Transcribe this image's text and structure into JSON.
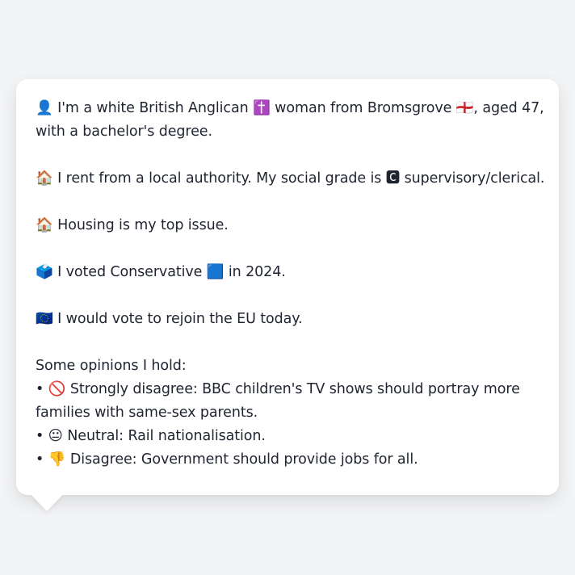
{
  "profile": {
    "identity_line1": "👤 I'm a white British Anglican ✝️ woman from Bromsgrove 🏴󠁧󠁢󠁥󠁮󠁧󠁿, aged 47,",
    "identity_line2": "with a bachelor's degree.",
    "housing_tenure": "🏠 I rent from a local authority. My social grade is 🅲 supervisory/clerical.",
    "top_issue": "🏠 Housing is my top issue.",
    "vote_2024": "🗳️ I voted Conservative 🟦 in 2024.",
    "eu_stance": "🇪🇺 I would vote to rejoin the EU today."
  },
  "opinions": {
    "heading": "Some opinions I hold:",
    "items": [
      {
        "line1": "• 🚫 Strongly disagree: BBC children's TV shows should portray more",
        "line2": "families with same-sex parents."
      },
      {
        "line1": "• 😐 Neutral: Rail nationalisation."
      },
      {
        "line1": "• 👎 Disagree: Government should provide jobs for all."
      }
    ]
  },
  "colors": {
    "page_background": "#f3f4f6",
    "bubble_background": "#ffffff",
    "text": "#1f2430"
  }
}
